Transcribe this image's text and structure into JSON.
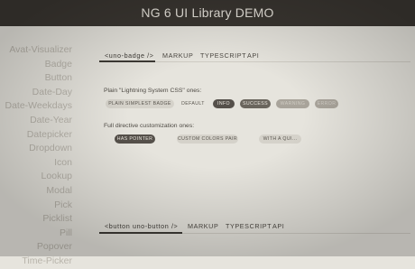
{
  "header": {
    "title": "NG 6 UI Library DEMO"
  },
  "sidebar": {
    "items": [
      "Avat-Visualizer",
      "Badge",
      "Button",
      "Date-Day",
      "Date-Weekdays",
      "Date-Year",
      "Datepicker",
      "Dropdown",
      "Icon",
      "Lookup",
      "Modal",
      "Pick",
      "Picklist",
      "Pill",
      "Popover",
      "Time-Picker"
    ]
  },
  "badge_section": {
    "tabs": [
      "<uno-badge />",
      "MARKUP",
      "TYPESCRIPT",
      "API"
    ],
    "plain_label": "Plain \"Lightning System CSS\" ones:",
    "plain_badges": [
      "PLAIN SIMPLEST BADGE",
      "DEFAULT",
      "INFO",
      "SUCCESS",
      "WARNING",
      "ERROR"
    ],
    "directive_label": "Full directive customization ones:",
    "directive_badges": [
      "HAS POINTER",
      "CUSTOM COLORS PAIR",
      "WITH A QUI..."
    ]
  },
  "button_section": {
    "tabs": [
      "<button uno-button />",
      "MARKUP",
      "TYPESCRIPT",
      "API"
    ]
  }
}
